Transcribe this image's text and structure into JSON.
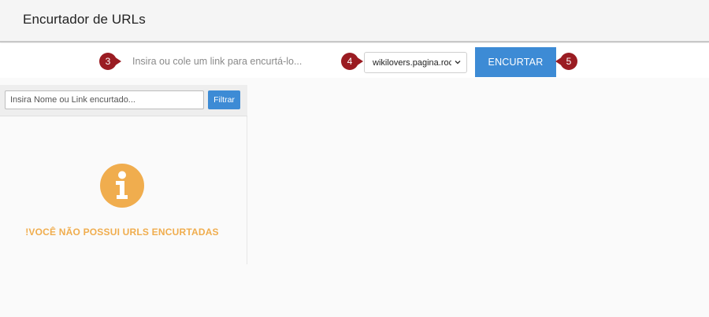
{
  "header": {
    "title": "Encurtador de URLs"
  },
  "toolbar": {
    "url_placeholder": "Insira ou cole um link para encurtá-lo...",
    "domain_selected": "wikilovers.pagina.rocks",
    "shorten_label": "ENCURTAR",
    "markers": [
      "3",
      "4",
      "5"
    ]
  },
  "panel": {
    "filter_placeholder": "Insira Nome ou Link encurtado...",
    "filter_label": "Filtrar",
    "empty_message": "!VOCÊ NÃO POSSUI URLS ENCURTADAS"
  },
  "colors": {
    "accent": "#3d8bd5",
    "marker": "#9a1c22",
    "warning": "#f0ad4e"
  }
}
